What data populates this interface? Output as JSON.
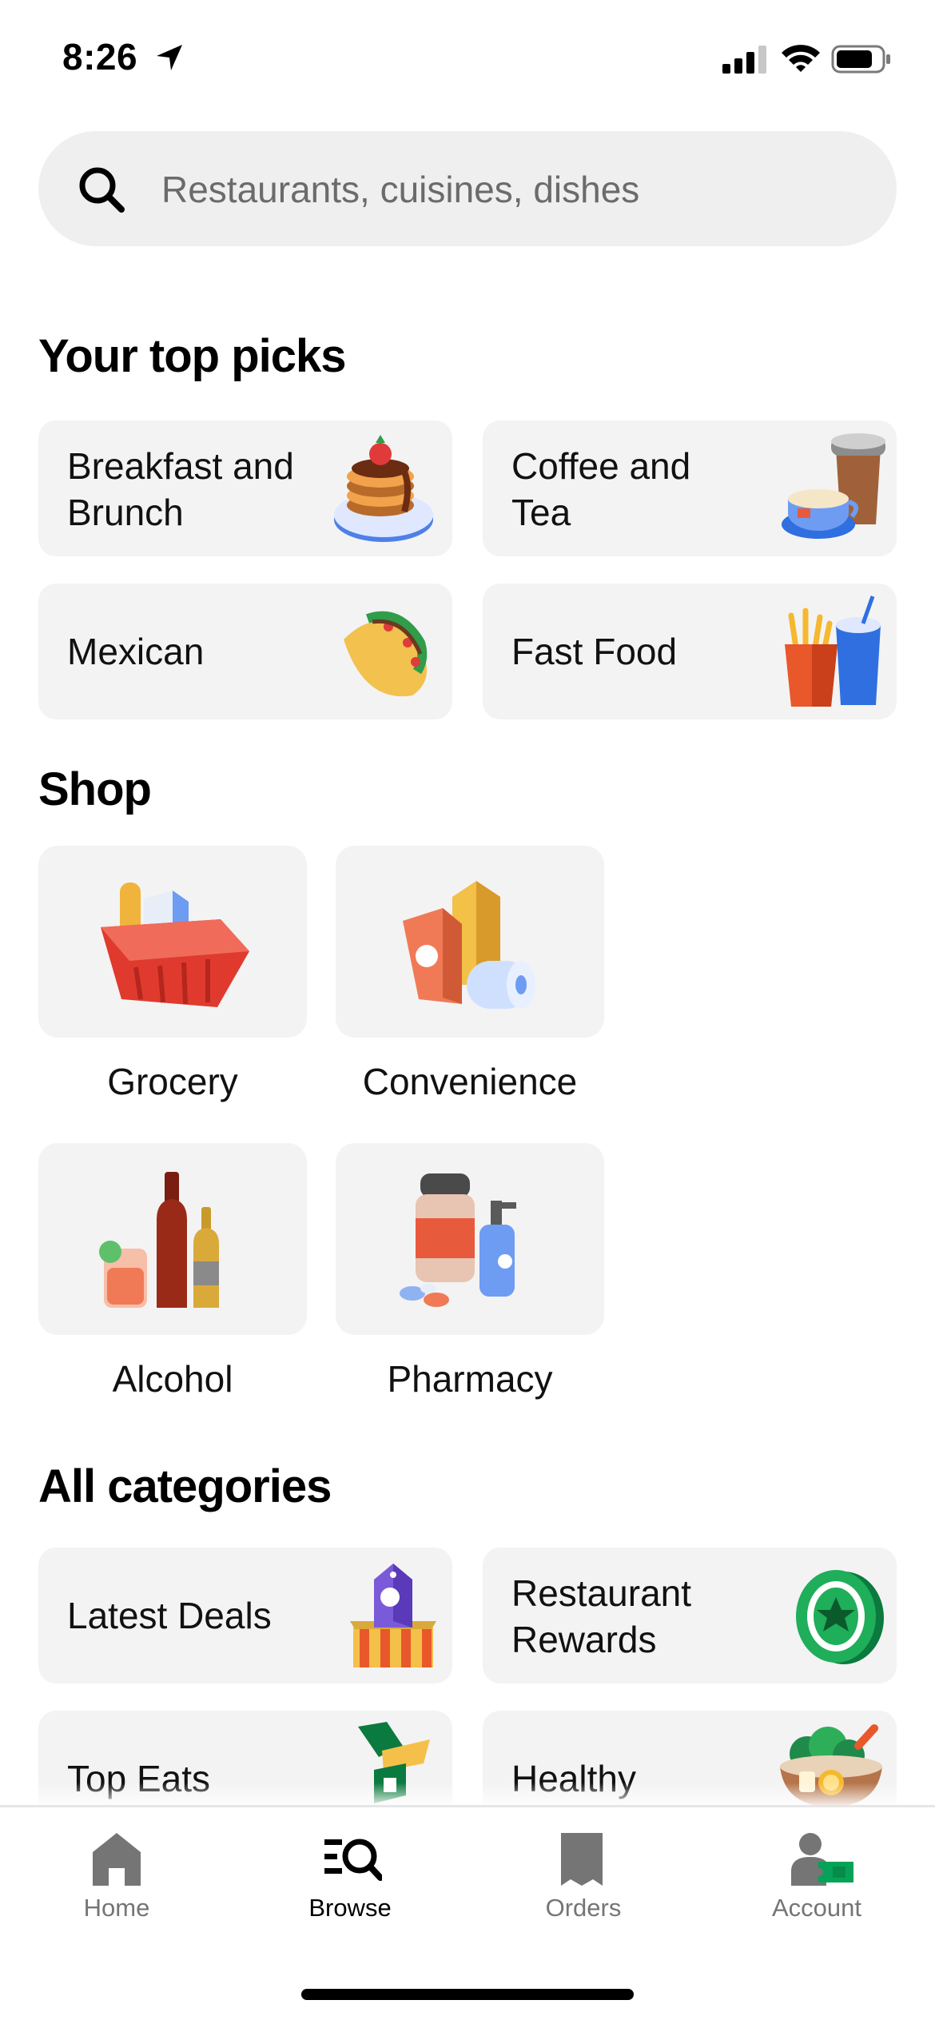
{
  "status_bar": {
    "time": "8:26"
  },
  "search": {
    "placeholder": "Restaurants, cuisines, dishes"
  },
  "top_picks": {
    "title": "Your top picks",
    "items": [
      {
        "label_line1": "Breakfast and",
        "label_line2": "Brunch",
        "icon": "pancakes-icon"
      },
      {
        "label_line1": "Coffee and",
        "label_line2": "Tea",
        "icon": "coffee-cup-icon"
      },
      {
        "label_line1": "Mexican",
        "label_line2": "",
        "icon": "taco-icon"
      },
      {
        "label_line1": "Fast Food",
        "label_line2": "",
        "icon": "fries-and-drink-icon"
      }
    ]
  },
  "shop": {
    "title": "Shop",
    "items": [
      {
        "label": "Grocery",
        "icon": "grocery-basket-icon"
      },
      {
        "label": "Convenience",
        "icon": "convenience-goods-icon"
      },
      {
        "label": "Alcohol",
        "icon": "alcohol-bottles-icon"
      },
      {
        "label": "Pharmacy",
        "icon": "pharmacy-bottles-icon"
      }
    ]
  },
  "all_categories": {
    "title": "All categories",
    "items": [
      {
        "label_line1": "Latest Deals",
        "label_line2": "",
        "icon": "deals-tag-icon"
      },
      {
        "label_line1": "Restaurant",
        "label_line2": "Rewards",
        "icon": "rewards-badge-icon"
      },
      {
        "label_line1": "Top Eats",
        "label_line2": "",
        "icon": "top-eats-icon"
      },
      {
        "label_line1": "Healthy",
        "label_line2": "",
        "icon": "salad-bowl-icon"
      }
    ]
  },
  "tab_bar": {
    "tabs": [
      {
        "label": "Home",
        "icon": "home-icon",
        "active": false
      },
      {
        "label": "Browse",
        "icon": "browse-icon",
        "active": true
      },
      {
        "label": "Orders",
        "icon": "receipt-icon",
        "active": false
      },
      {
        "label": "Account",
        "icon": "account-icon",
        "active": false
      }
    ]
  },
  "colors": {
    "accent_green": "#05a357",
    "tile_bg": "#f3f3f3",
    "search_bg": "#efefef",
    "inactive_tab": "#757575"
  }
}
